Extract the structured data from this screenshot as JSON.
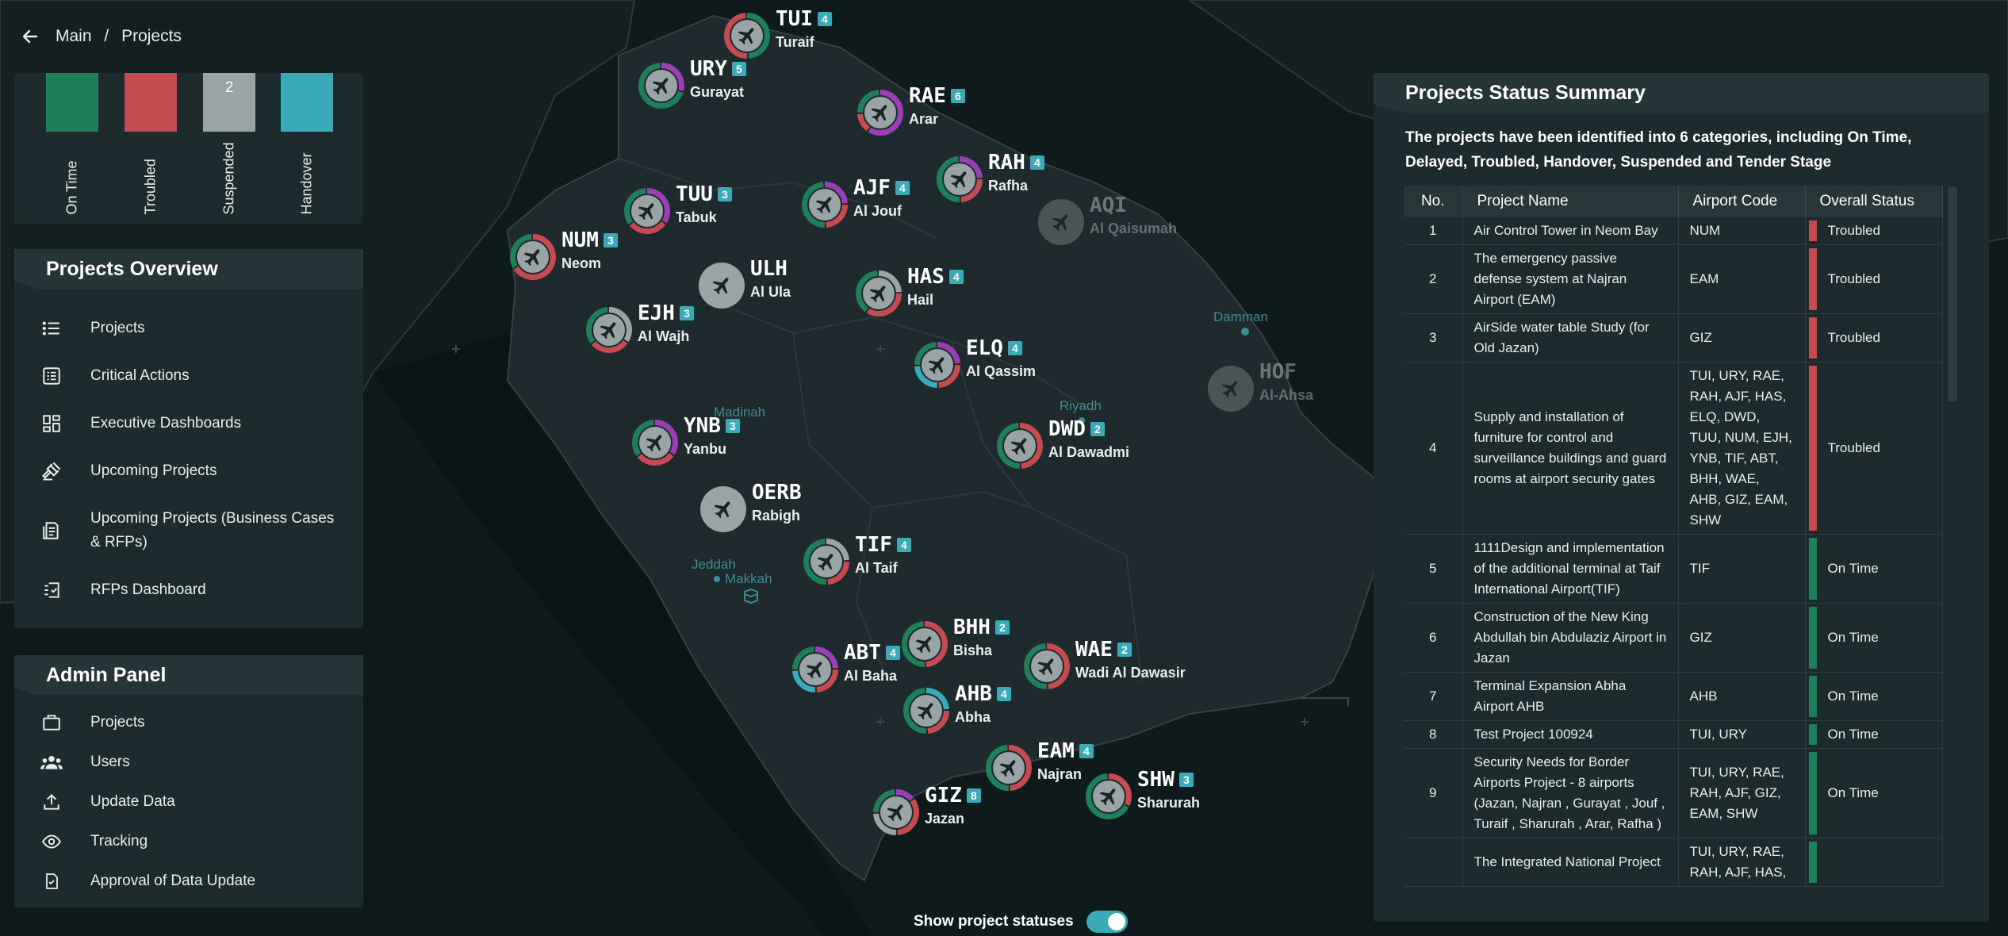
{
  "breadcrumb": {
    "items": [
      "Main",
      "Projects"
    ],
    "separator": "/"
  },
  "legend": [
    {
      "label": "On Time",
      "color": "#1e7f5a",
      "count": ""
    },
    {
      "label": "Troubled",
      "color": "#c44b4f",
      "count": ""
    },
    {
      "label": "Suspended",
      "color": "#9aa3a6",
      "count": "2"
    },
    {
      "label": "Handover",
      "color": "#3aa9b8",
      "count": ""
    }
  ],
  "overview": {
    "title": "Projects Overview",
    "items": [
      {
        "label": "Projects",
        "icon": "list-icon"
      },
      {
        "label": "Critical Actions",
        "icon": "checklist-icon"
      },
      {
        "label": "Executive Dashboards",
        "icon": "dashboard-icon"
      },
      {
        "label": "Upcoming Projects",
        "icon": "gavel-icon"
      },
      {
        "label": "Upcoming Projects (Business Cases & RFPs)",
        "icon": "document-icon"
      },
      {
        "label": "RFPs Dashboard",
        "icon": "checkbox-icon"
      }
    ]
  },
  "admin": {
    "title": "Admin Panel",
    "items": [
      {
        "label": "Projects",
        "icon": "briefcase-icon"
      },
      {
        "label": "Users",
        "icon": "users-icon"
      },
      {
        "label": "Update Data",
        "icon": "upload-icon"
      },
      {
        "label": "Tracking",
        "icon": "eye-icon"
      },
      {
        "label": "Approval of Data Update",
        "icon": "approval-icon"
      }
    ]
  },
  "colors": {
    "ontime": "#1e7f5a",
    "troubled": "#c44b4f",
    "suspended": "#9aa3a6",
    "handover": "#3aa9b8",
    "purple": "#9b3fb5",
    "accent": "#3aa9b8"
  },
  "airports": [
    {
      "code": "TUI",
      "city": "Turaif",
      "count": "4"
    },
    {
      "code": "URY",
      "city": "Gurayat",
      "count": "5"
    },
    {
      "code": "RAE",
      "city": "Arar",
      "count": "6"
    },
    {
      "code": "RAH",
      "city": "Rafha",
      "count": "4"
    },
    {
      "code": "AQI",
      "city": "Al Qaisumah",
      "count": ""
    },
    {
      "code": "TUU",
      "city": "Tabuk",
      "count": "3"
    },
    {
      "code": "AJF",
      "city": "Al Jouf",
      "count": "4"
    },
    {
      "code": "NUM",
      "city": "Neom",
      "count": "3"
    },
    {
      "code": "ULH",
      "city": "Al Ula",
      "count": ""
    },
    {
      "code": "HAS",
      "city": "Hail",
      "count": "4"
    },
    {
      "code": "EJH",
      "city": "Al Wajh",
      "count": "3"
    },
    {
      "code": "ELQ",
      "city": "Al Qassim",
      "count": "4"
    },
    {
      "code": "HOF",
      "city": "Al-Ahsa",
      "count": ""
    },
    {
      "code": "YNB",
      "city": "Yanbu",
      "count": "3"
    },
    {
      "code": "DWD",
      "city": "Al Dawadmi",
      "count": "2"
    },
    {
      "code": "OERB",
      "city": "Rabigh",
      "count": ""
    },
    {
      "code": "TIF",
      "city": "Al Taif",
      "count": "4"
    },
    {
      "code": "BHH",
      "city": "Bisha",
      "count": "2"
    },
    {
      "code": "WAE",
      "city": "Wadi Al Dawasir",
      "count": "2"
    },
    {
      "code": "ABT",
      "city": "Al Baha",
      "count": "4"
    },
    {
      "code": "AHB",
      "city": "Abha",
      "count": "4"
    },
    {
      "code": "EAM",
      "city": "Najran",
      "count": "4"
    },
    {
      "code": "SHW",
      "city": "Sharurah",
      "count": "3"
    },
    {
      "code": "GIZ",
      "city": "Jazan",
      "count": "8"
    }
  ],
  "map_labels": [
    "Damman",
    "Riyadh",
    "Madinah",
    "Jeddah",
    "Makkah"
  ],
  "toggle": {
    "label": "Show project statuses",
    "on": true
  },
  "summary": {
    "title": "Projects Status Summary",
    "intro": "The projects have been identified into 6 categories, including On Time, Delayed, Troubled, Handover, Suspended and Tender Stage",
    "columns": [
      "No.",
      "Project Name",
      "Airport Code",
      "Overall Status"
    ],
    "rows": [
      {
        "no": "1",
        "name": "Air Control Tower in Neom Bay",
        "code": "NUM",
        "status": "Troubled",
        "color": "#c44b4f"
      },
      {
        "no": "2",
        "name": "The emergency passive defense system at Najran Airport (EAM)",
        "code": "EAM",
        "status": "Troubled",
        "color": "#c44b4f"
      },
      {
        "no": "3",
        "name": "AirSide water table Study (for Old Jazan)",
        "code": "GIZ",
        "status": "Troubled",
        "color": "#c44b4f"
      },
      {
        "no": "4",
        "name": "Supply and installation of furniture for control and surveillance buildings and guard rooms at airport security gates",
        "code": "TUI, URY, RAE, RAH, AJF, HAS, ELQ, DWD, TUU, NUM, EJH, YNB, TIF, ABT, BHH, WAE, AHB, GIZ, EAM, SHW",
        "status": "Troubled",
        "color": "#c44b4f"
      },
      {
        "no": "5",
        "name": "1111Design and implementation of the additional terminal at Taif International Airport(TIF)",
        "code": "TIF",
        "status": "On Time",
        "color": "#1e7f5a"
      },
      {
        "no": "6",
        "name": "Construction of the New King Abdullah bin Abdulaziz Airport in Jazan",
        "code": "GIZ",
        "status": "On Time",
        "color": "#1e7f5a"
      },
      {
        "no": "7",
        "name": "Terminal Expansion Abha Airport AHB",
        "code": "AHB",
        "status": "On Time",
        "color": "#1e7f5a"
      },
      {
        "no": "8",
        "name": "Test Project 100924",
        "code": "TUI, URY",
        "status": "On Time",
        "color": "#1e7f5a"
      },
      {
        "no": "9",
        "name": "Security Needs for Border Airports Project - 8 airports (Jazan, Najran , Gurayat , Jouf , Turaif , Sharurah , Arar, Rafha )",
        "code": "TUI, URY, RAE, RAH, AJF, GIZ, EAM, SHW",
        "status": "On Time",
        "color": "#1e7f5a"
      },
      {
        "no": "",
        "name": "The Integrated National Project",
        "code": "TUI, URY, RAE, RAH, AJF, HAS,",
        "status": "",
        "color": "#1e7f5a"
      }
    ]
  }
}
